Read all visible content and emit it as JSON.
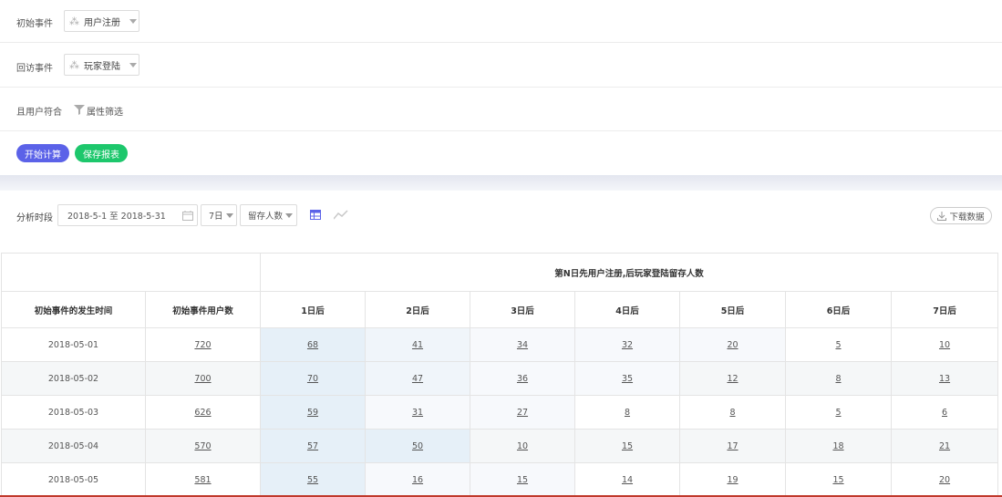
{
  "filters": {
    "start_event_label": "初始事件",
    "start_event_value": "用户注册",
    "return_event_label": "回访事件",
    "return_event_value": "玩家登陆",
    "user_match_label": "且用户符合",
    "attribute_filter_label": "属性筛选"
  },
  "actions": {
    "calc_label": "开始计算",
    "save_label": "保存报表"
  },
  "toolbar": {
    "period_label": "分析时段",
    "date_range": "2018-5-1 至 2018-5-31",
    "days_value": "7日",
    "metric_value": "留存人数",
    "download_label": "下载数据",
    "accent_color": "#5b62e8"
  },
  "table": {
    "group_header": "第N日先用户注册,后玩家登陆留存人数",
    "col_date": "初始事件的发生时间",
    "col_users": "初始事件用户数",
    "day_headers": [
      "1日后",
      "2日后",
      "3日后",
      "4日后",
      "5日后",
      "6日后",
      "7日后"
    ],
    "rows": [
      {
        "date": "2018-05-01",
        "users": "720",
        "days": [
          "68",
          "41",
          "34",
          "32",
          "20",
          "5",
          "10"
        ]
      },
      {
        "date": "2018-05-02",
        "users": "700",
        "days": [
          "70",
          "47",
          "36",
          "35",
          "12",
          "8",
          "13"
        ]
      },
      {
        "date": "2018-05-03",
        "users": "626",
        "days": [
          "59",
          "31",
          "27",
          "8",
          "8",
          "5",
          "6"
        ]
      },
      {
        "date": "2018-05-04",
        "users": "570",
        "days": [
          "57",
          "50",
          "10",
          "15",
          "17",
          "18",
          "21"
        ]
      },
      {
        "date": "2018-05-05",
        "users": "581",
        "days": [
          "55",
          "16",
          "15",
          "14",
          "19",
          "15",
          "20"
        ]
      }
    ]
  }
}
